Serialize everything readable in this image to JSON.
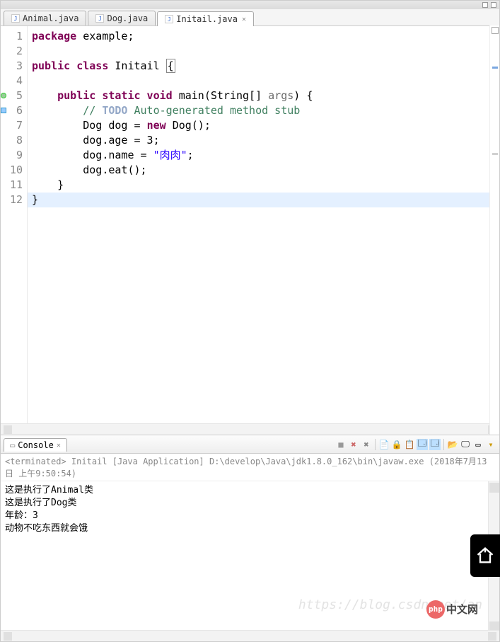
{
  "tabs": [
    {
      "label": "Animal.java"
    },
    {
      "label": "Dog.java"
    },
    {
      "label": "Initail.java",
      "active": true
    }
  ],
  "code": {
    "lines": [
      {
        "n": "1",
        "segments": [
          {
            "t": "package ",
            "c": "kw"
          },
          {
            "t": "example;",
            "c": ""
          }
        ]
      },
      {
        "n": "2",
        "segments": []
      },
      {
        "n": "3",
        "segments": [
          {
            "t": "public class ",
            "c": "kw"
          },
          {
            "t": "Initail ",
            "c": ""
          },
          {
            "t": "{",
            "c": "hlbox"
          }
        ]
      },
      {
        "n": "4",
        "segments": []
      },
      {
        "n": "5",
        "marker": "green",
        "segments": [
          {
            "t": "    ",
            "c": ""
          },
          {
            "t": "public static void ",
            "c": "kw"
          },
          {
            "t": "main(String[] ",
            "c": ""
          },
          {
            "t": "args",
            "c": "param"
          },
          {
            "t": ") {",
            "c": ""
          }
        ]
      },
      {
        "n": "6",
        "marker": "blue",
        "segments": [
          {
            "t": "        // ",
            "c": "cmt"
          },
          {
            "t": "TODO",
            "c": "cmt-todo"
          },
          {
            "t": " Auto-generated method stub",
            "c": "cmt"
          }
        ]
      },
      {
        "n": "7",
        "segments": [
          {
            "t": "        Dog dog = ",
            "c": ""
          },
          {
            "t": "new ",
            "c": "kw"
          },
          {
            "t": "Dog();",
            "c": ""
          }
        ]
      },
      {
        "n": "8",
        "segments": [
          {
            "t": "        dog.age = 3;",
            "c": ""
          }
        ]
      },
      {
        "n": "9",
        "segments": [
          {
            "t": "        dog.name = ",
            "c": ""
          },
          {
            "t": "\"肉肉\"",
            "c": "str"
          },
          {
            "t": ";",
            "c": ""
          }
        ]
      },
      {
        "n": "10",
        "segments": [
          {
            "t": "        dog.eat();",
            "c": ""
          }
        ]
      },
      {
        "n": "11",
        "segments": [
          {
            "t": "    }",
            "c": ""
          }
        ]
      },
      {
        "n": "12",
        "hl": true,
        "segments": [
          {
            "t": "}",
            "c": ""
          }
        ]
      }
    ]
  },
  "console": {
    "tab_label": "Console",
    "status": "<terminated> Initail [Java Application] D:\\develop\\Java\\jdk1.8.0_162\\bin\\javaw.exe (2018年7月13日 上午9:50:54)",
    "output": [
      "这是执行了Animal类",
      "这是执行了Dog类",
      "年龄：3",
      "动物不吃东西就会饿"
    ]
  },
  "watermark": "https://blog.csdn.net/an",
  "logo": {
    "badge": "php",
    "text": "中文网"
  },
  "icons": {
    "stop": "■",
    "remove_x": "✖",
    "remove_xx": "✖",
    "clear": "📄",
    "lock": "🔒",
    "pin": "📋",
    "d1": "🗔",
    "d2": "🗔",
    "open": "📂",
    "mon": "🖵",
    "menu": "▾"
  }
}
